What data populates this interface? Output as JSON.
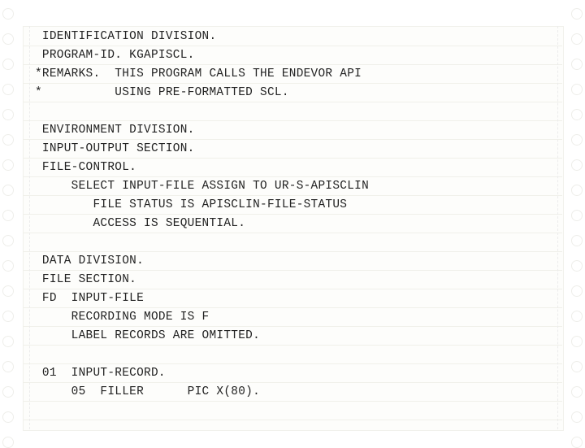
{
  "listing": {
    "lines": [
      " IDENTIFICATION DIVISION.",
      " PROGRAM-ID. KGAPISCL.",
      "*REMARKS.  THIS PROGRAM CALLS THE ENDEVOR API",
      "*          USING PRE-FORMATTED SCL.",
      "",
      " ENVIRONMENT DIVISION.",
      " INPUT-OUTPUT SECTION.",
      " FILE-CONTROL.",
      "     SELECT INPUT-FILE ASSIGN TO UR-S-APISCLIN",
      "        FILE STATUS IS APISCLIN-FILE-STATUS",
      "        ACCESS IS SEQUENTIAL.",
      "",
      " DATA DIVISION.",
      " FILE SECTION.",
      " FD  INPUT-FILE",
      "     RECORDING MODE IS F",
      "     LABEL RECORDS ARE OMITTED.",
      "",
      " 01  INPUT-RECORD.",
      "     05  FILLER      PIC X(80)."
    ]
  }
}
